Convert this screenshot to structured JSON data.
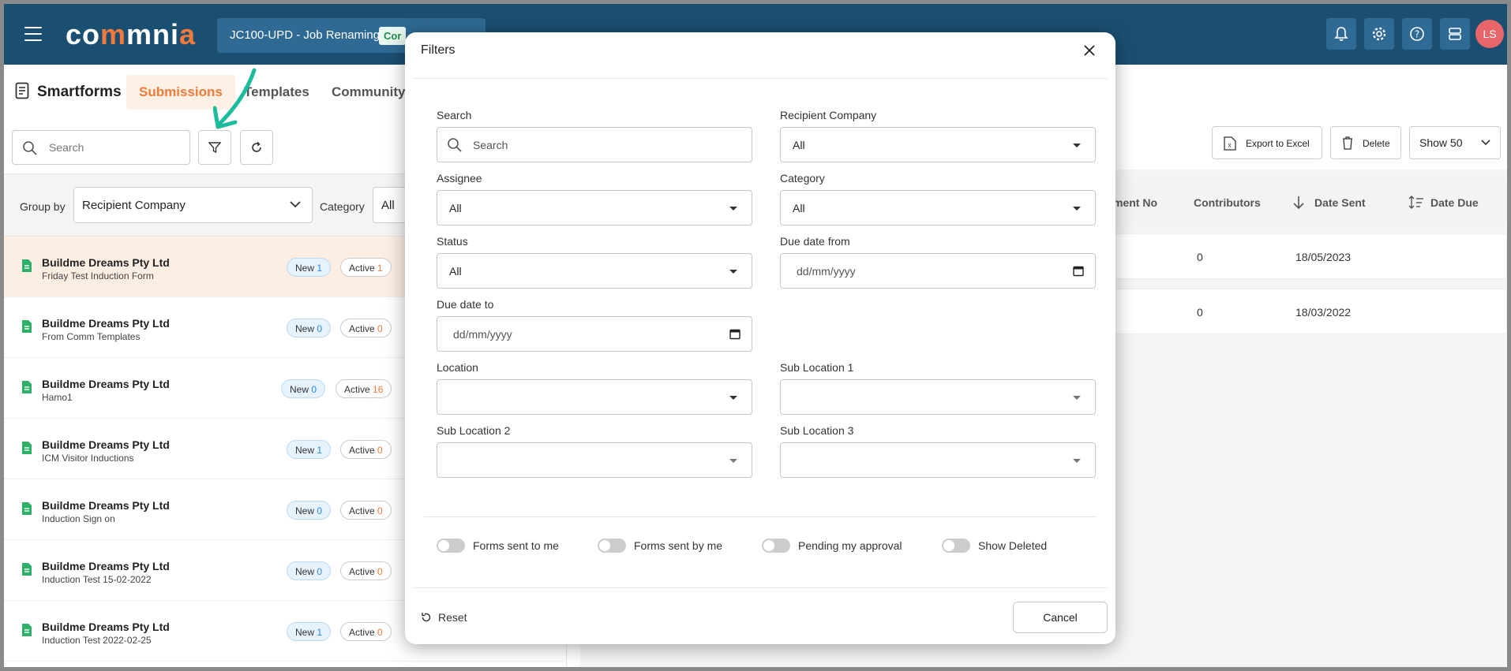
{
  "app": {
    "brand": "commnia",
    "project_name": "JC100-UPD - Job Renaming",
    "project_badge": "Cor",
    "avatar_initials": "LS",
    "colors": {
      "topbar": "#1b4f72",
      "accent": "#f27a3a",
      "avatar": "#e8656a"
    }
  },
  "nav": {
    "section_title": "Smartforms",
    "tabs": [
      {
        "label": "Submissions",
        "active": true
      },
      {
        "label": "Templates",
        "active": false
      },
      {
        "label": "Community",
        "active": false
      }
    ]
  },
  "toolbar": {
    "search_placeholder": "Search",
    "group_by_label": "Group by",
    "group_by_value": "Recipient Company",
    "category_label": "Category",
    "category_value": "All"
  },
  "list": {
    "items": [
      {
        "company": "Buildme Dreams Pty Ltd",
        "form": "Friday Test Induction Form",
        "new_label": "New",
        "new_count": "1",
        "active_label": "Active",
        "active_count": "1"
      },
      {
        "company": "Buildme Dreams Pty Ltd",
        "form": "From Comm Templates",
        "new_label": "New",
        "new_count": "0",
        "active_label": "Active",
        "active_count": "0"
      },
      {
        "company": "Buildme Dreams Pty Ltd",
        "form": "Hamo1",
        "new_label": "New",
        "new_count": "0",
        "active_label": "Active",
        "active_count": "16"
      },
      {
        "company": "Buildme Dreams Pty Ltd",
        "form": "ICM Visitor Inductions",
        "new_label": "New",
        "new_count": "1",
        "active_label": "Active",
        "active_count": "0"
      },
      {
        "company": "Buildme Dreams Pty Ltd",
        "form": "Induction Sign on",
        "new_label": "New",
        "new_count": "0",
        "active_label": "Active",
        "active_count": "0"
      },
      {
        "company": "Buildme Dreams Pty Ltd",
        "form": "Induction Test 15-02-2022",
        "new_label": "New",
        "new_count": "0",
        "active_label": "Active",
        "active_count": "0"
      },
      {
        "company": "Buildme Dreams Pty Ltd",
        "form": "Induction Test 2022-02-25",
        "new_label": "New",
        "new_count": "1",
        "active_label": "Active",
        "active_count": "0"
      }
    ]
  },
  "right": {
    "export_label": "Export to Excel",
    "delete_label": "Delete",
    "show_label": "Show 50",
    "columns": [
      "ment No",
      "Contributors",
      "Date Sent",
      "Date Due"
    ],
    "rows": [
      {
        "contributors": "0",
        "date_sent": "18/05/2023"
      },
      {
        "contributors": "0",
        "date_sent": "18/03/2022"
      }
    ]
  },
  "modal": {
    "title": "Filters",
    "search_label": "Search",
    "search_placeholder": "Search",
    "recipient_company_label": "Recipient Company",
    "recipient_company_value": "All",
    "assignee_label": "Assignee",
    "assignee_value": "All",
    "category_label": "Category",
    "category_value": "All",
    "status_label": "Status",
    "status_value": "All",
    "due_from_label": "Due date from",
    "due_from_placeholder": "dd/mm/yyyy",
    "due_to_label": "Due date to",
    "due_to_placeholder": "dd/mm/yyyy",
    "location_label": "Location",
    "sub1_label": "Sub Location 1",
    "sub2_label": "Sub Location 2",
    "sub3_label": "Sub Location 3",
    "toggles": [
      "Forms sent to me",
      "Forms sent by me",
      "Pending my approval",
      "Show Deleted"
    ],
    "reset_label": "Reset",
    "cancel_label": "Cancel"
  }
}
